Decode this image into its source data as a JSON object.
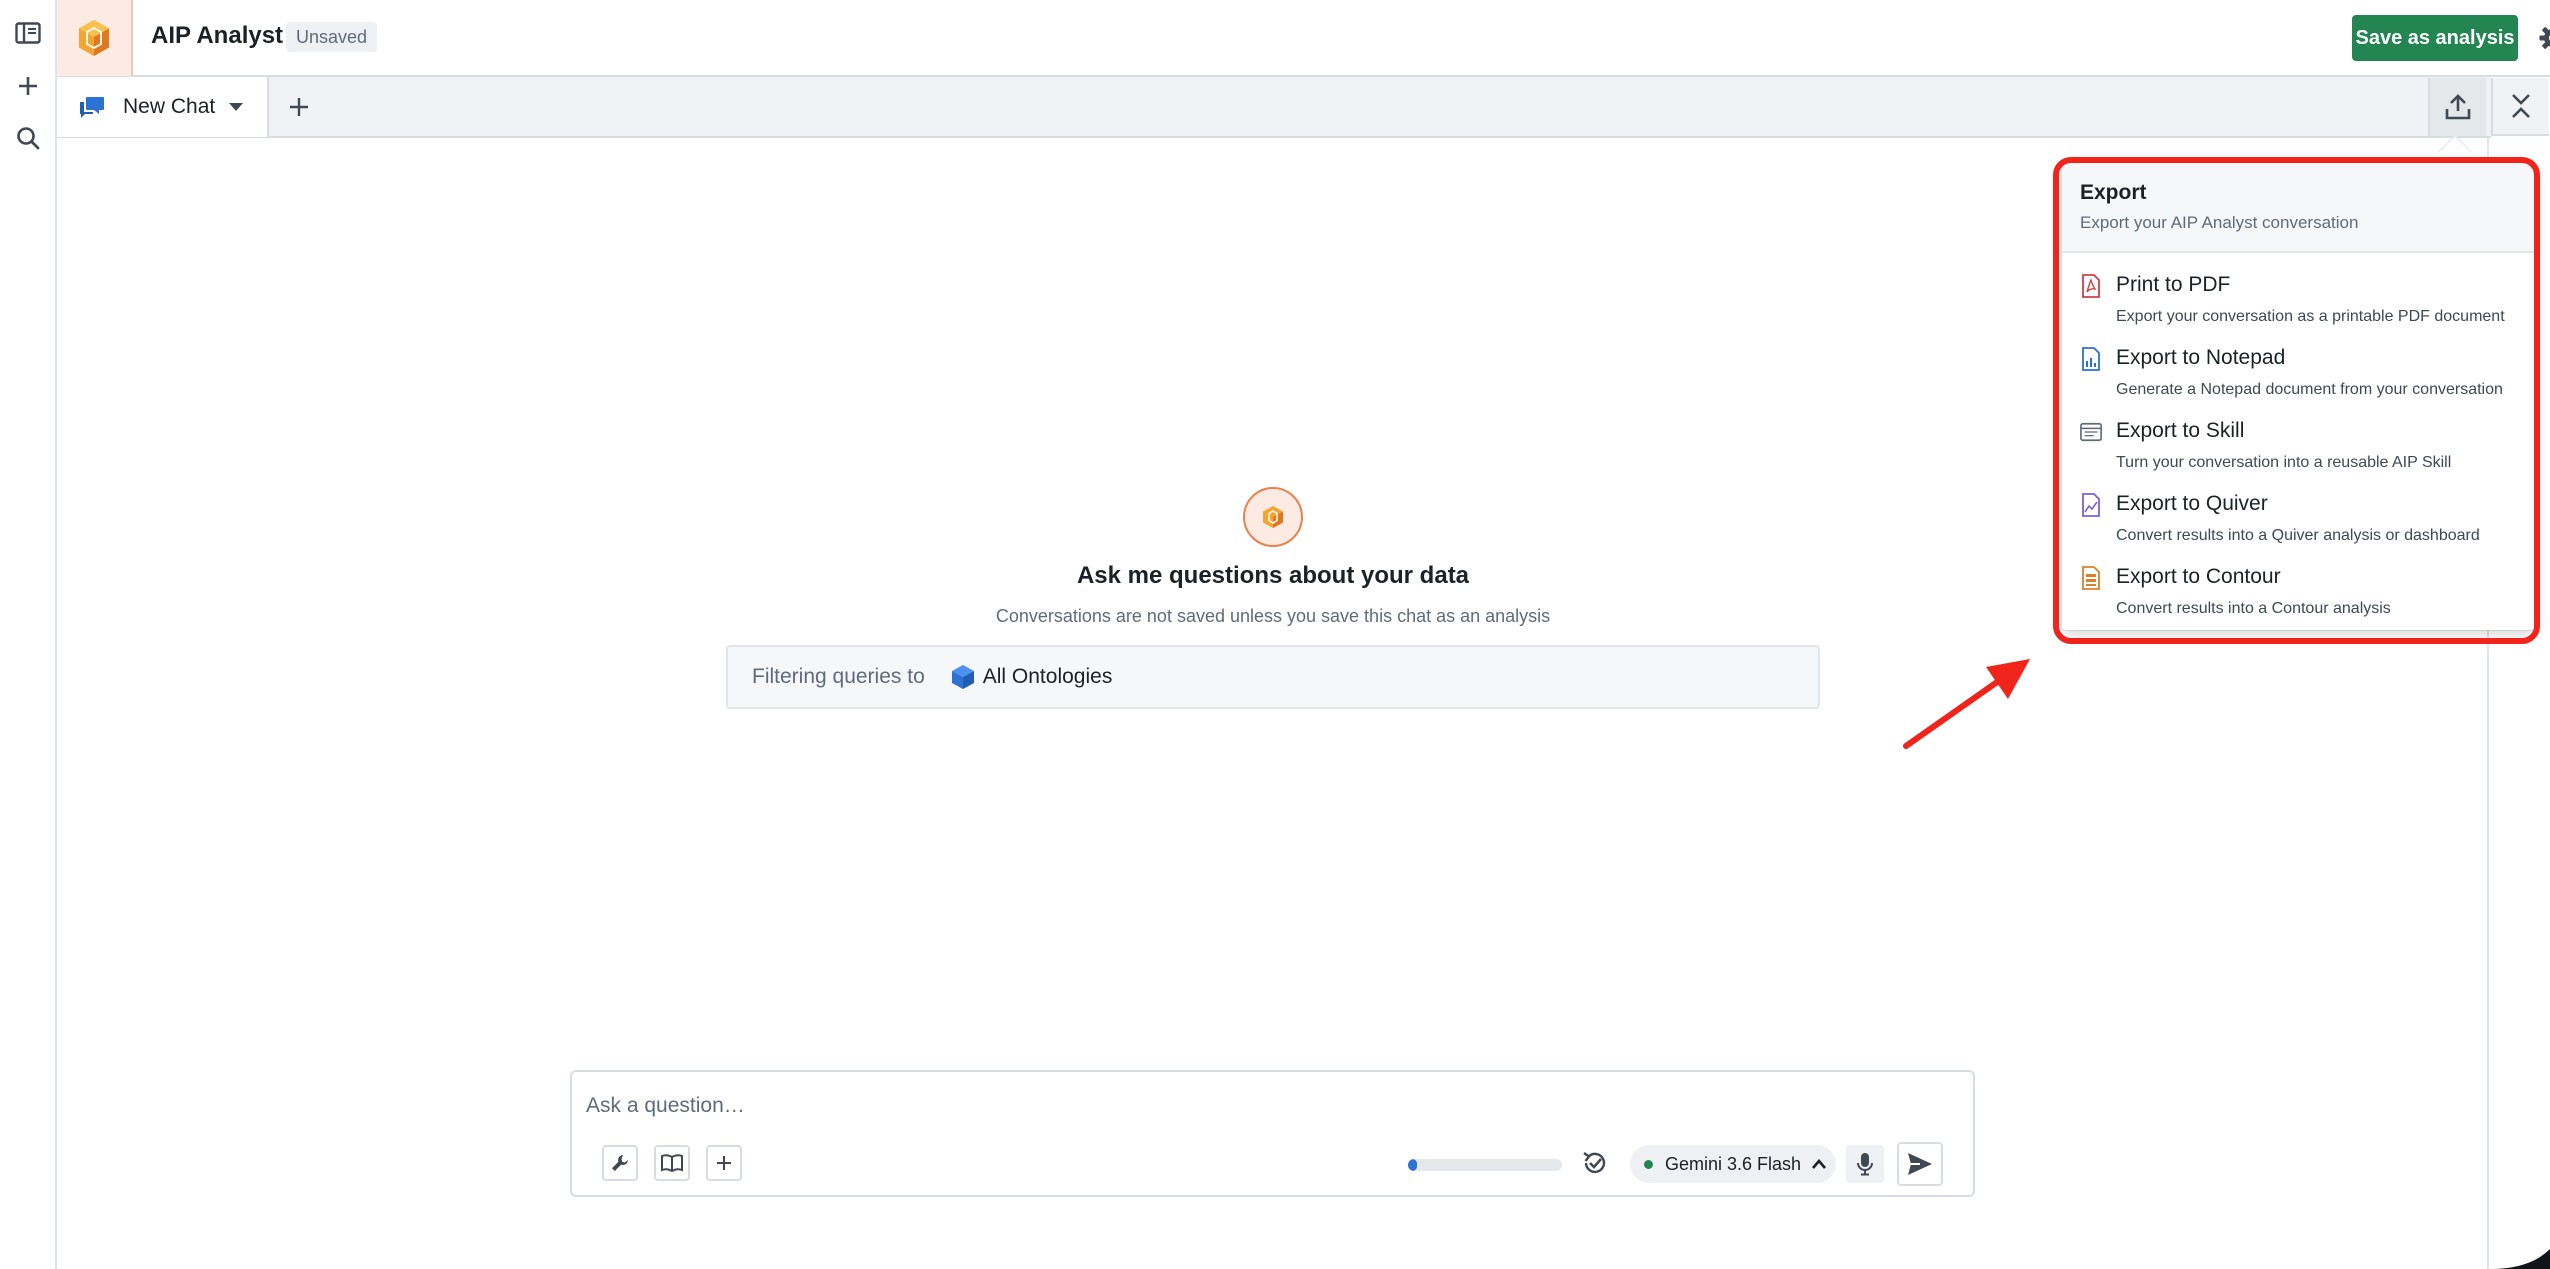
{
  "header": {
    "app_title": "AIP Analyst",
    "status_badge": "Unsaved",
    "save_button": "Save as analysis"
  },
  "tabs": {
    "active_tab_label": "New Chat"
  },
  "empty_state": {
    "title": "Ask me questions about your data",
    "subtitle": "Conversations are not saved unless you save this chat as an analysis",
    "filter_label": "Filtering queries to",
    "ontology_label": "All Ontologies"
  },
  "composer": {
    "placeholder": "Ask a question…",
    "progress_fraction": 0.06,
    "model_label": "Gemini 3.6 Flash"
  },
  "export_menu": {
    "title": "Export",
    "subtitle": "Export your AIP Analyst conversation",
    "items": [
      {
        "label": "Print to PDF",
        "description": "Export your conversation as a printable PDF document",
        "icon": "pdf-icon"
      },
      {
        "label": "Export to Notepad",
        "description": "Generate a Notepad document from your conversation",
        "icon": "notepad-icon"
      },
      {
        "label": "Export to Skill",
        "description": "Turn your conversation into a reusable AIP Skill",
        "icon": "skill-icon"
      },
      {
        "label": "Export to Quiver",
        "description": "Convert results into a Quiver analysis or dashboard",
        "icon": "quiver-icon"
      },
      {
        "label": "Export to Contour",
        "description": "Convert results into a Contour analysis",
        "icon": "contour-icon"
      }
    ]
  },
  "colors": {
    "brand_orange": "#e8824f",
    "primary_green": "#238551",
    "accent_blue": "#2d72d2",
    "highlight_red": "#f0241a"
  }
}
